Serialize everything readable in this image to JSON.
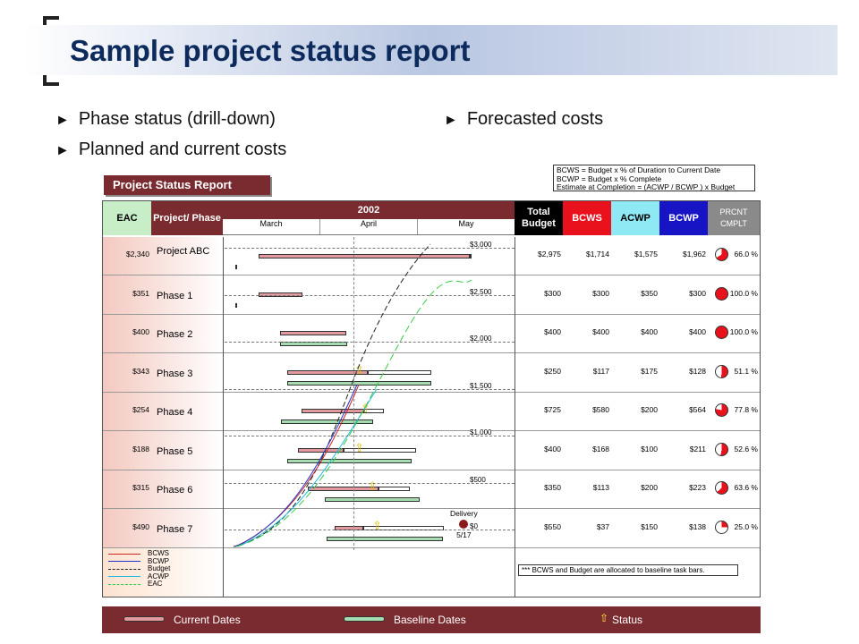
{
  "slide": {
    "title": "Sample project status report",
    "bullets_left": [
      "Phase status (drill-down)",
      "Planned and current costs"
    ],
    "bullets_right": [
      "Forecasted costs"
    ],
    "marker": "►"
  },
  "report": {
    "title": "Project Status Report",
    "formulas": [
      "BCWS = Budget x % of Duration to Current Date",
      "BCWP = Budget x % Complete",
      "Estimate at Completion = (ACWP / BCWP ) x Budget"
    ],
    "headers": {
      "eac": "EAC",
      "phase": "Project/ Phase",
      "year": "2002",
      "months": [
        "March",
        "April",
        "May"
      ],
      "total": "Total Budget",
      "bcws": "BCWS",
      "acwp": "ACWP",
      "bcwp": "BCWP",
      "pct": "PRCNT CMPLT"
    },
    "rows": [
      {
        "eac": "$2,340",
        "name": "Project ABC",
        "total": "$2,975",
        "bcws": "$1,714",
        "acwp": "$1,575",
        "bcwp": "$1,962",
        "pct": "66.0 %",
        "p": 0.66
      },
      {
        "eac": "$351",
        "name": "Phase 1",
        "total": "$300",
        "bcws": "$300",
        "acwp": "$350",
        "bcwp": "$300",
        "pct": "100.0 %",
        "p": 1
      },
      {
        "eac": "$400",
        "name": "Phase 2",
        "total": "$400",
        "bcws": "$400",
        "acwp": "$400",
        "bcwp": "$400",
        "pct": "100.0 %",
        "p": 1
      },
      {
        "eac": "$343",
        "name": "Phase 3",
        "total": "$250",
        "bcws": "$117",
        "acwp": "$175",
        "bcwp": "$128",
        "pct": "51.1 %",
        "p": 0.511
      },
      {
        "eac": "$254",
        "name": "Phase 4",
        "total": "$725",
        "bcws": "$580",
        "acwp": "$200",
        "bcwp": "$564",
        "pct": "77.8 %",
        "p": 0.778
      },
      {
        "eac": "$188",
        "name": "Phase 5",
        "total": "$400",
        "bcws": "$168",
        "acwp": "$100",
        "bcwp": "$211",
        "pct": "52.6 %",
        "p": 0.526
      },
      {
        "eac": "$315",
        "name": "Phase 6",
        "total": "$350",
        "bcws": "$113",
        "acwp": "$200",
        "bcwp": "$223",
        "pct": "63.6 %",
        "p": 0.636
      },
      {
        "eac": "$490",
        "name": "Phase 7",
        "total": "$550",
        "bcws": "$37",
        "acwp": "$150",
        "bcwp": "$138",
        "pct": "25.0 %",
        "p": 0.25
      }
    ],
    "cost_axis": [
      "$3,000",
      "$2,500",
      "$2,000",
      "$1,500",
      "$1,000",
      "$500",
      "$0"
    ],
    "delivery": "Delivery",
    "delivery_date": "5/17",
    "legend": [
      {
        "name": "BCWS",
        "color": "#cc2222"
      },
      {
        "name": "BCWP",
        "color": "#2233cc"
      },
      {
        "name": "Budget",
        "color": "#222222"
      },
      {
        "name": "ACWP",
        "color": "#22bbdd"
      },
      {
        "name": "EAC",
        "color": "#33cc44"
      }
    ],
    "note": "*** BCWS and Budget are allocated to baseline task bars.",
    "footer": {
      "current": "Current Dates",
      "baseline": "Baseline Dates",
      "status": "Status"
    }
  }
}
